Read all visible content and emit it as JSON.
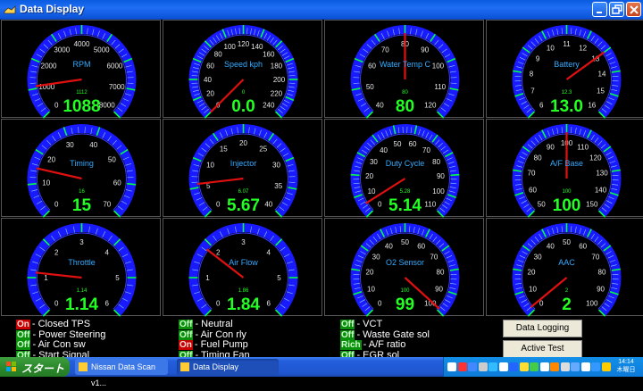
{
  "window": {
    "title": "Data Display"
  },
  "colors": {
    "gauge_arc": "#1a1aff",
    "tick_green": "#00ff44",
    "needle": "#e01010",
    "value_green": "#22ff22",
    "label_blue": "#33aaff"
  },
  "gauges": [
    {
      "label": "RPM",
      "min": 0,
      "max": 8000,
      "ticks": [
        "0",
        "1000",
        "2000",
        "3000",
        "4000",
        "5000",
        "6000",
        "7000",
        "8000"
      ],
      "small": "1112",
      "display": "1088",
      "value": 1088
    },
    {
      "label": "Speed kph",
      "min": 0,
      "max": 240,
      "ticks": [
        "0",
        "20",
        "40",
        "60",
        "80",
        "100",
        "120",
        "140",
        "160",
        "180",
        "200",
        "220",
        "240"
      ],
      "small": "0",
      "display": "0.0",
      "value": 0
    },
    {
      "label": "Water Temp C",
      "min": 40,
      "max": 120,
      "ticks": [
        "40",
        "50",
        "60",
        "70",
        "80",
        "90",
        "100",
        "110",
        "120"
      ],
      "small": "80",
      "display": "80",
      "value": 80
    },
    {
      "label": "Battery",
      "min": 6,
      "max": 16,
      "ticks": [
        "6",
        "7",
        "8",
        "9",
        "10",
        "11",
        "12",
        "13",
        "14",
        "15",
        "16"
      ],
      "small": "12.3",
      "display": "13.0",
      "value": 13.0
    },
    {
      "label": "Timing",
      "min": 0,
      "max": 70,
      "ticks": [
        "0",
        "10",
        "20",
        "30",
        "40",
        "50",
        "60",
        "70"
      ],
      "small": "16",
      "display": "15",
      "value": 15
    },
    {
      "label": "Injector",
      "min": 0,
      "max": 40,
      "ticks": [
        "0",
        "5",
        "10",
        "15",
        "20",
        "25",
        "30",
        "35",
        "40"
      ],
      "small": "6.07",
      "display": "5.67",
      "value": 5.67
    },
    {
      "label": "Duty Cycle",
      "min": 0,
      "max": 110,
      "ticks": [
        "0",
        "10",
        "20",
        "30",
        "40",
        "50",
        "60",
        "70",
        "80",
        "90",
        "100",
        "110"
      ],
      "small": "5.28",
      "display": "5.14",
      "value": 5.14
    },
    {
      "label": "A/F Base",
      "min": 50,
      "max": 150,
      "ticks": [
        "50",
        "60",
        "70",
        "80",
        "90",
        "100",
        "110",
        "120",
        "130",
        "140",
        "150"
      ],
      "small": "100",
      "display": "100",
      "value": 100
    },
    {
      "label": "Throttle",
      "min": 0,
      "max": 6,
      "ticks": [
        "0",
        "1",
        "2",
        "3",
        "4",
        "5",
        "6"
      ],
      "small": "1.14",
      "display": "1.14",
      "value": 1.14
    },
    {
      "label": "Air Flow",
      "min": 0,
      "max": 6,
      "ticks": [
        "0",
        "1",
        "2",
        "3",
        "4",
        "5",
        "6"
      ],
      "small": "1.86",
      "display": "1.84",
      "value": 1.84
    },
    {
      "label": "O2 Sensor",
      "min": 0,
      "max": 100,
      "ticks": [
        "0",
        "10",
        "20",
        "30",
        "40",
        "50",
        "60",
        "70",
        "80",
        "90",
        "100"
      ],
      "small": "100",
      "display": "99",
      "value": 99
    },
    {
      "label": "AAC",
      "min": 0,
      "max": 100,
      "ticks": [
        "0",
        "10",
        "20",
        "30",
        "40",
        "50",
        "60",
        "70",
        "80",
        "90",
        "100"
      ],
      "small": "2",
      "display": "2",
      "value": 2
    }
  ],
  "status_items": [
    {
      "state": "On",
      "kind": "on",
      "label": "- Closed TPS"
    },
    {
      "state": "Off",
      "kind": "off",
      "label": "- Power Steering"
    },
    {
      "state": "Off",
      "kind": "off",
      "label": "- Air Con sw"
    },
    {
      "state": "Off",
      "kind": "off",
      "label": "- Start Signal"
    },
    {
      "state": "Off",
      "kind": "off",
      "label": "- Neutral"
    },
    {
      "state": "Off",
      "kind": "off",
      "label": "- Air Con rly"
    },
    {
      "state": "On",
      "kind": "on",
      "label": "- Fuel Pump"
    },
    {
      "state": "Off",
      "kind": "off",
      "label": "- Timing Fan"
    },
    {
      "state": "Off",
      "kind": "off",
      "label": "- VCT"
    },
    {
      "state": "Off",
      "kind": "off",
      "label": "- Waste Gate sol"
    },
    {
      "state": "Rich",
      "kind": "rich",
      "label": "- A/F ratio"
    },
    {
      "state": "Off",
      "kind": "off",
      "label": "- EGR sol"
    }
  ],
  "buttons": {
    "data_logging": "Data Logging",
    "active_test": "Active Test"
  },
  "taskbar": {
    "start_label": "スタート",
    "tasks": [
      "Nissan Data Scan v1...",
      "Data Display"
    ],
    "clock_time": "14:14",
    "clock_day": "木曜日"
  }
}
